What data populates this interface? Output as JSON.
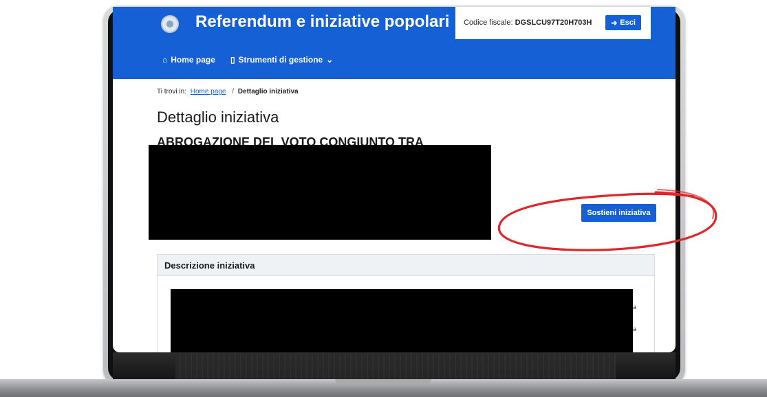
{
  "header": {
    "site_title": "Referendum e iniziative popolari",
    "fiscal_label": "Codice fiscale:",
    "fiscal_code": "DGSLCU97T20H703H",
    "logout_label": "Esci",
    "logout_icon": "sign-out-icon",
    "emblem_icon": "emblem-icon"
  },
  "nav": {
    "items": [
      {
        "label": "Home page",
        "icon": "home-icon"
      },
      {
        "label": "Strumenti di gestione",
        "icon": "tablet-icon",
        "chevron": "chevron-down-icon"
      }
    ]
  },
  "breadcrumb": {
    "prefix": "Ti trovi in:",
    "home": "Home page",
    "separator": "/",
    "current": "Dettaglio iniziativa"
  },
  "main": {
    "page_title": "Dettaglio iniziativa",
    "subtitle": "ABROGAZIONE DEL VOTO CONGIUNTO TRA",
    "support_button": "Sostieni iniziativa",
    "description_header": "Descrizione iniziativa",
    "edge_letters": [
      "a",
      "a"
    ]
  },
  "colors": {
    "primary": "#1560d4",
    "annotation": "#e0262a",
    "redaction": "#000000"
  }
}
